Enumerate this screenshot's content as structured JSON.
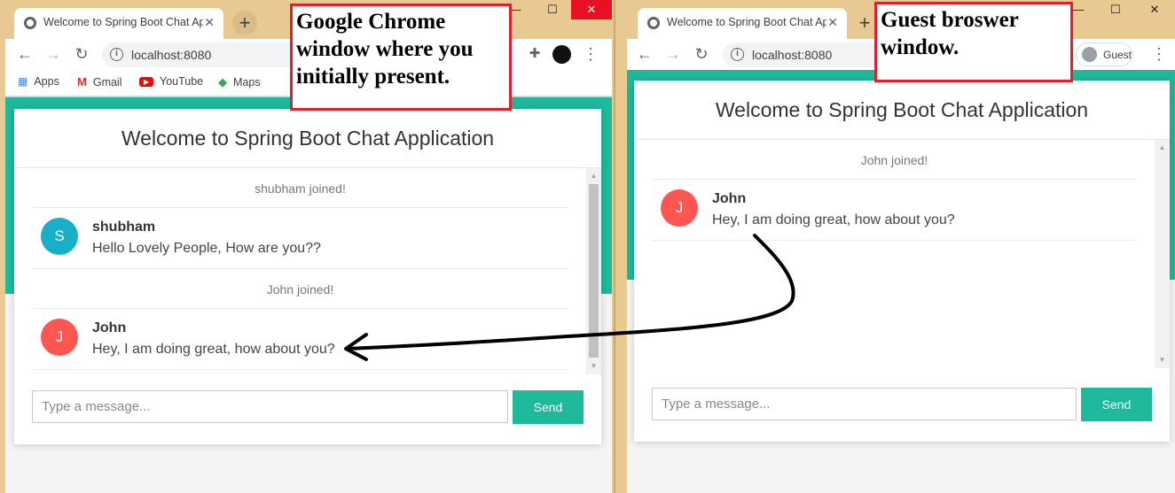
{
  "left_window": {
    "tab_title": "Welcome to Spring Boot Chat Ap",
    "url": "localhost:8080",
    "bookmarks": [
      "Apps",
      "Gmail",
      "YouTube",
      "Maps"
    ],
    "chat": {
      "header": "Welcome to Spring Boot Chat Application",
      "events": [
        "shubham joined!",
        "John joined!"
      ],
      "messages": [
        {
          "avatar": "S",
          "sender": "shubham",
          "text": "Hello Lovely People, How are you??",
          "color": "#1aafc9"
        },
        {
          "avatar": "J",
          "sender": "John",
          "text": "Hey, I am doing great, how about you?",
          "color": "#ff5652"
        }
      ],
      "input_placeholder": "Type a message...",
      "send_label": "Send"
    }
  },
  "right_window": {
    "tab_title": "Welcome to Spring Boot Chat Ap",
    "url": "localhost:8080",
    "profile_label": "Guest",
    "chat": {
      "header": "Welcome to Spring Boot Chat Application",
      "events": [
        "John joined!"
      ],
      "messages": [
        {
          "avatar": "J",
          "sender": "John",
          "text": "Hey, I am doing great, how about you?",
          "color": "#ff5652"
        }
      ],
      "input_placeholder": "Type a message...",
      "send_label": "Send"
    }
  },
  "annotations": {
    "left": "Google Chrome window where you initially present.",
    "right": "Guest broswer window."
  },
  "colors": {
    "accent": "#1eb99b",
    "frame": "#e8c991",
    "annotation_border": "#e0202c"
  }
}
